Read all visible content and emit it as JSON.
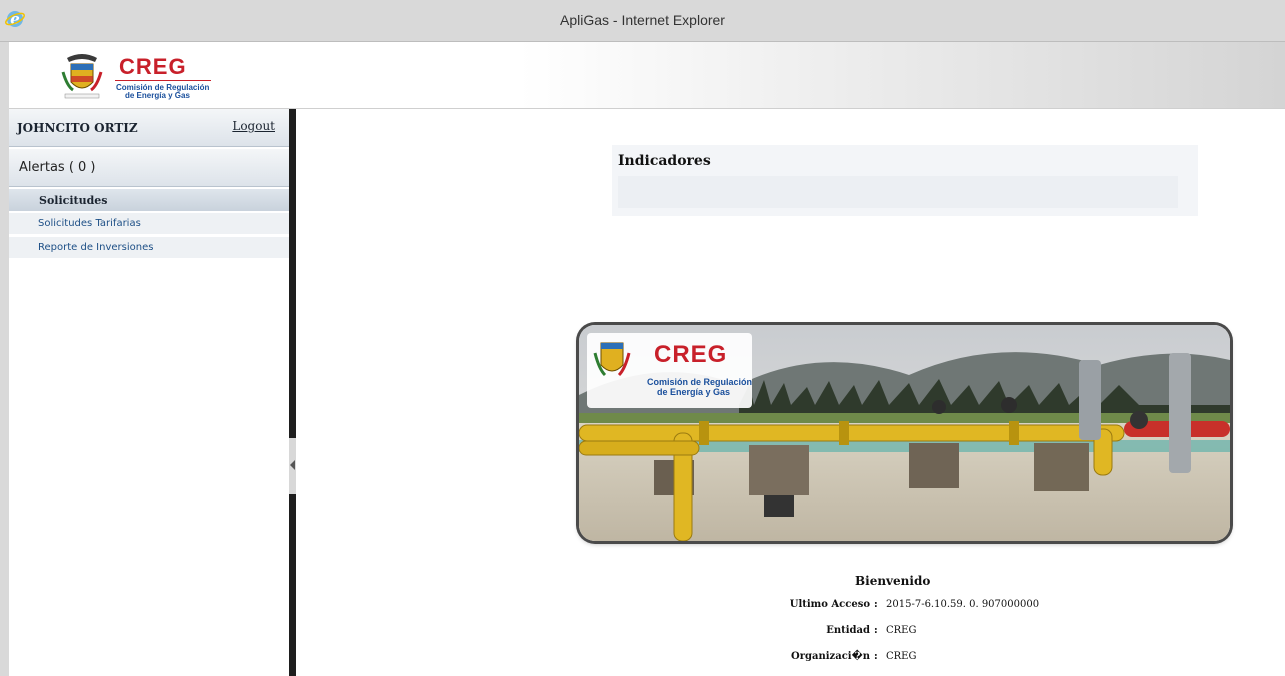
{
  "window": {
    "title": "ApliGas - Internet Explorer"
  },
  "header": {
    "logo_text": "CREG",
    "logo_line1": "Comisión de Regulación",
    "logo_line2": "de Energía y Gas"
  },
  "sidebar": {
    "user_name": "JOHNCITO ORTIZ",
    "logout_label": "Logout",
    "alerts_label": "Alertas ( 0 )",
    "section_label": "Solicitudes",
    "items": [
      {
        "label": "Solicitudes Tarifarias"
      },
      {
        "label": "Reporte de Inversiones"
      }
    ]
  },
  "main": {
    "indicadores_title": "Indicadores",
    "banner": {
      "logo_text": "CREG",
      "logo_line1": "Comisión de Regulación",
      "logo_line2": "de Energía y Gas"
    },
    "welcome": "Bienvenido",
    "info": [
      {
        "label": "Ultimo Acceso",
        "value": "2015-7-6.10.59. 0. 907000000"
      },
      {
        "label": "Entidad",
        "value": "CREG"
      },
      {
        "label": "Organizaci�n",
        "value": "CREG"
      }
    ]
  },
  "colors": {
    "brand_red": "#c8202a",
    "brand_blue": "#1a4f9c",
    "link_blue": "#1d4f86"
  }
}
